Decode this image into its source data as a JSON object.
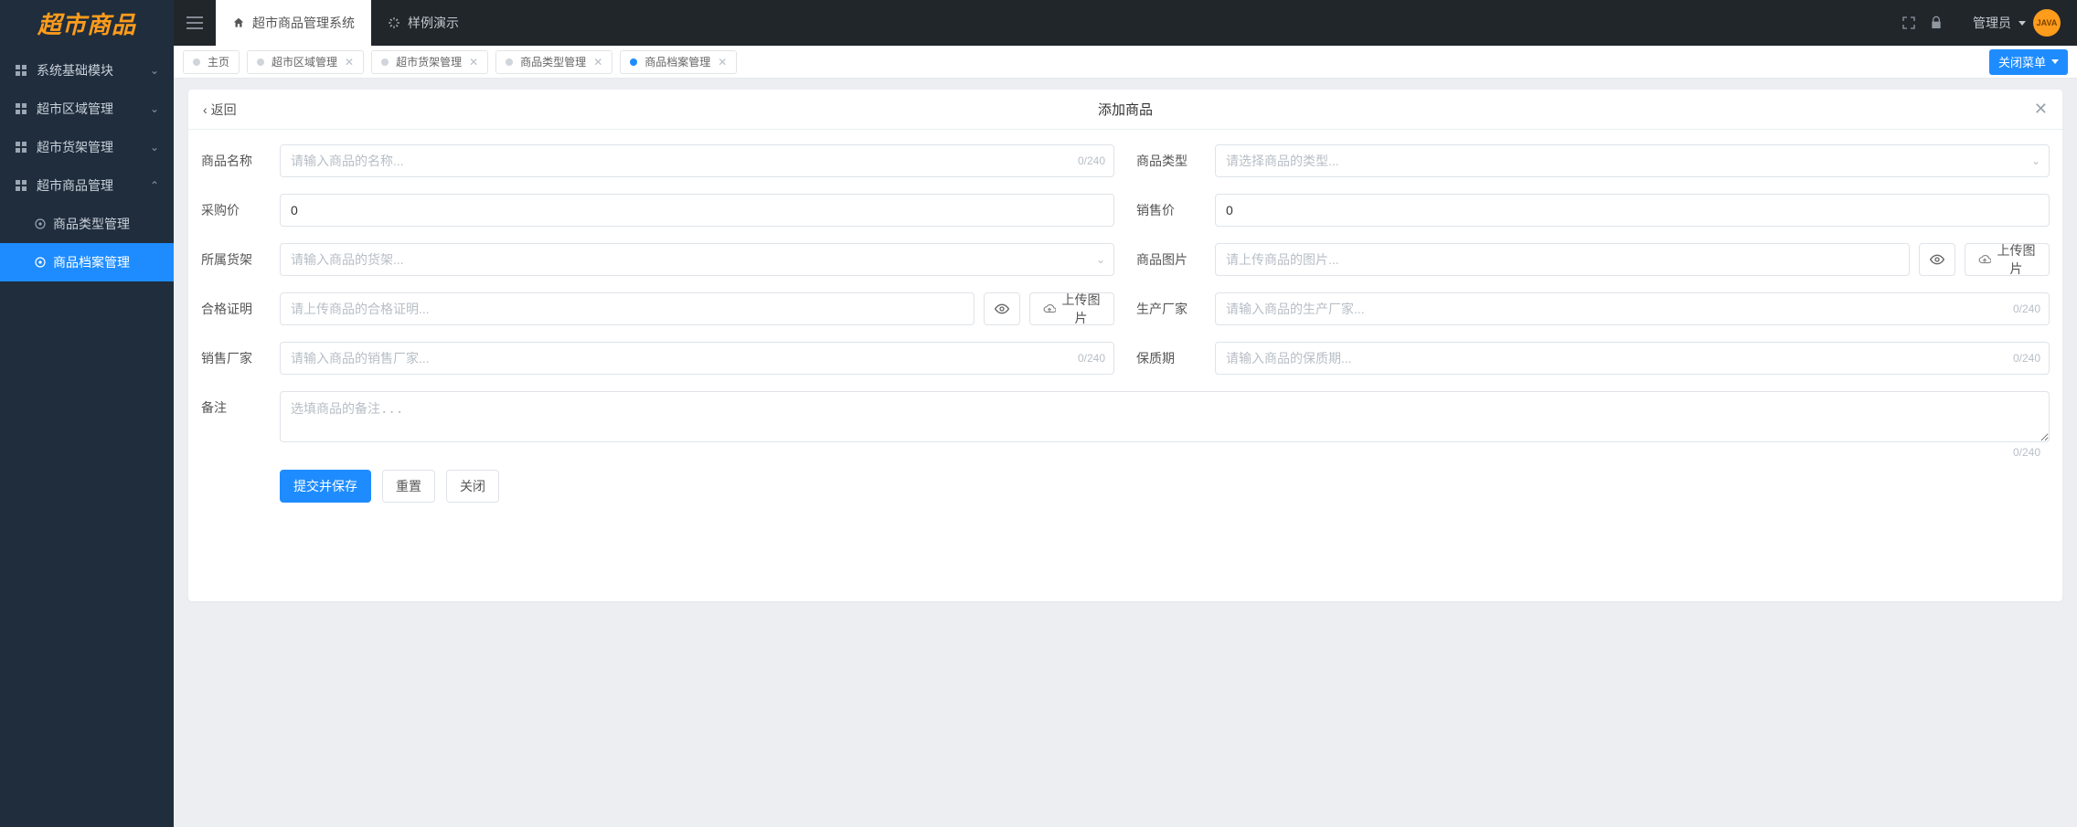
{
  "logo_text": "超市商品",
  "sidebar": {
    "items": [
      {
        "label": "系统基础模块",
        "expanded": false
      },
      {
        "label": "超市区域管理",
        "expanded": false
      },
      {
        "label": "超市货架管理",
        "expanded": false
      },
      {
        "label": "超市商品管理",
        "expanded": true
      }
    ],
    "subitems": [
      {
        "label": "商品类型管理",
        "active": false
      },
      {
        "label": "商品档案管理",
        "active": true
      }
    ]
  },
  "top": {
    "primary_tab": "超市商品管理系统",
    "secondary_tab": "样例演示",
    "admin_label": "管理员",
    "avatar_text": "JAVA"
  },
  "tabs": [
    {
      "label": "主页",
      "closable": false,
      "active": false
    },
    {
      "label": "超市区域管理",
      "closable": true,
      "active": false
    },
    {
      "label": "超市货架管理",
      "closable": true,
      "active": false
    },
    {
      "label": "商品类型管理",
      "closable": true,
      "active": false
    },
    {
      "label": "商品档案管理",
      "closable": true,
      "active": true
    }
  ],
  "close_menu_label": "关闭菜单",
  "panel": {
    "back_label": "返回",
    "title": "添加商品"
  },
  "form": {
    "name_label": "商品名称",
    "name_placeholder": "请输入商品的名称...",
    "name_counter": "0/240",
    "type_label": "商品类型",
    "type_placeholder": "请选择商品的类型...",
    "purchase_label": "采购价",
    "purchase_value": "0",
    "sale_label": "销售价",
    "sale_value": "0",
    "shelf_label": "所属货架",
    "shelf_placeholder": "请输入商品的货架...",
    "image_label": "商品图片",
    "image_placeholder": "请上传商品的图片...",
    "upload_btn": "上传图片",
    "cert_label": "合格证明",
    "cert_placeholder": "请上传商品的合格证明...",
    "producer_label": "生产厂家",
    "producer_placeholder": "请输入商品的生产厂家...",
    "producer_counter": "0/240",
    "seller_label": "销售厂家",
    "seller_placeholder": "请输入商品的销售厂家...",
    "seller_counter": "0/240",
    "shelflife_label": "保质期",
    "shelflife_placeholder": "请输入商品的保质期...",
    "shelflife_counter": "0/240",
    "remark_label": "备注",
    "remark_placeholder": "选填商品的备注...",
    "remark_counter": "0/240",
    "submit_btn": "提交并保存",
    "reset_btn": "重置",
    "close_btn": "关闭"
  }
}
